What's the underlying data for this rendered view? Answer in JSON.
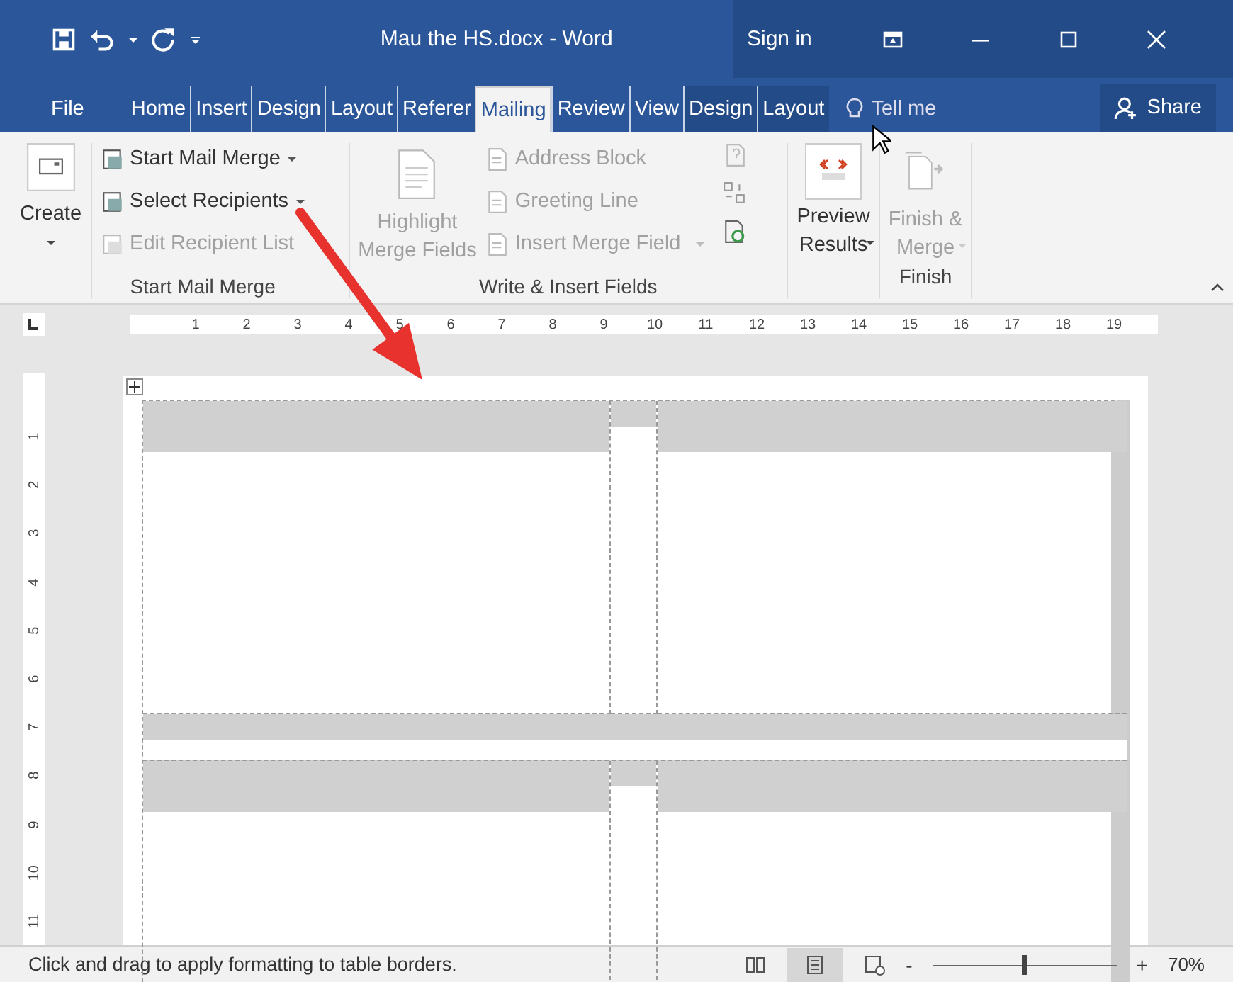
{
  "window": {
    "title": "Mau the HS.docx  -  Word",
    "sign_in": "Sign in"
  },
  "tabs": [
    {
      "label": "File",
      "selected": false,
      "kind": "file"
    },
    {
      "label": "Home",
      "selected": false,
      "kind": "normal"
    },
    {
      "label": "Insert",
      "selected": false,
      "kind": "normal"
    },
    {
      "label": "Design",
      "selected": false,
      "kind": "normal"
    },
    {
      "label": "Layout",
      "selected": false,
      "kind": "normal"
    },
    {
      "label": "Referer",
      "selected": false,
      "kind": "normal"
    },
    {
      "label": "Mailing",
      "selected": true,
      "kind": "normal"
    },
    {
      "label": "Review",
      "selected": false,
      "kind": "normal"
    },
    {
      "label": "View",
      "selected": false,
      "kind": "normal"
    },
    {
      "label": "Design",
      "selected": false,
      "kind": "context"
    },
    {
      "label": "Layout",
      "selected": false,
      "kind": "context"
    }
  ],
  "tell_me": "Tell me",
  "share": "Share",
  "ribbon": {
    "create": {
      "label": "Create"
    },
    "start_items": [
      {
        "label": "Start Mail Merge",
        "disabled": false,
        "dropdown": true
      },
      {
        "label": "Select Recipients",
        "disabled": false,
        "dropdown": true
      },
      {
        "label": "Edit Recipient List",
        "disabled": true,
        "dropdown": false
      }
    ],
    "start_group": "Start Mail Merge",
    "highlight": {
      "label_1": "Highlight",
      "label_2": "Merge Fields",
      "disabled": true
    },
    "field_items": [
      {
        "label": "Address Block",
        "disabled": true,
        "dropdown": false
      },
      {
        "label": "Greeting Line",
        "disabled": true,
        "dropdown": false
      },
      {
        "label": "Insert Merge Field",
        "disabled": true,
        "dropdown": true
      }
    ],
    "write_group": "Write & Insert Fields",
    "preview": {
      "label_1": "Preview",
      "label_2": "Results",
      "disabled": false
    },
    "finish": {
      "label_1": "Finish &",
      "label_2": "Merge",
      "disabled": true
    },
    "finish_group": "Finish"
  },
  "ruler": {
    "h_marks": [
      "1",
      "2",
      "3",
      "4",
      "5",
      "6",
      "7",
      "8",
      "9",
      "10",
      "11",
      "12",
      "13",
      "14",
      "15",
      "16",
      "17",
      "18",
      "19"
    ],
    "v_marks": [
      "1",
      "2",
      "3",
      "4",
      "5",
      "6",
      "7",
      "8",
      "9",
      "10",
      "11"
    ]
  },
  "status_bar": {
    "text": "Click and drag to apply formatting to table borders.",
    "zoom": "70%",
    "zoom_out": "-",
    "zoom_in": "+",
    "zoom_slider": {
      "level": 0.5
    }
  }
}
